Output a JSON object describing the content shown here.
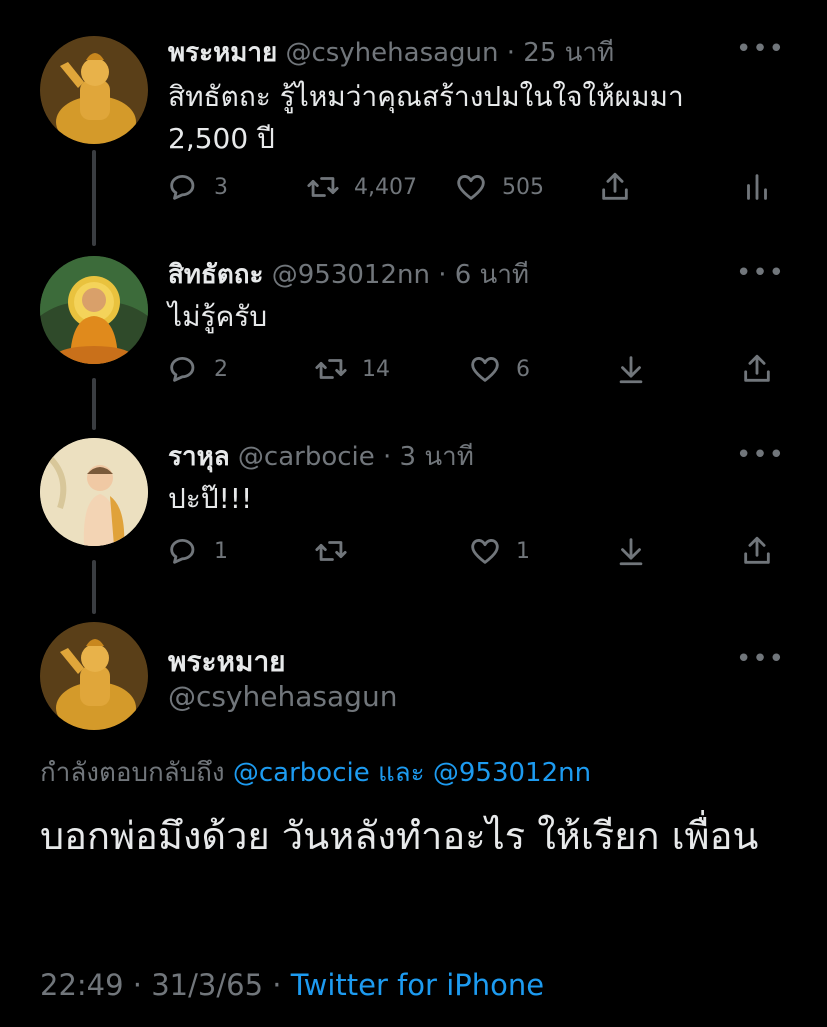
{
  "tweets": [
    {
      "name": "พระหมาย",
      "handle": "@csyhehasagun",
      "time": "· 25 นาที",
      "text": "สิทธัตถะ รู้ไหมว่าคุณสร้างปมในใจให้ผมมา 2,500 ปี",
      "replies": "3",
      "retweets": "4,407",
      "likes": "505"
    },
    {
      "name": "สิทธัตถะ",
      "handle": "@953012nn",
      "time": "· 6 นาที",
      "text": "ไม่รู้ครับ",
      "replies": "2",
      "retweets": "14",
      "likes": "6"
    },
    {
      "name": "ราหุล",
      "handle": "@carbocie",
      "time": "· 3 นาที",
      "text": "ปะป๊!!!",
      "replies": "1",
      "retweets": "",
      "likes": "1"
    }
  ],
  "main": {
    "name": "พระหมาย",
    "handle": "@csyhehasagun",
    "replying_prefix": "กำลังตอบกลับถึง",
    "reply_to_1": "@carbocie",
    "and": "และ",
    "reply_to_2": "@953012nn",
    "text": "บอกพ่อมึงด้วย วันหลังทำอะไร ให้เรียก เพื่อน",
    "timestamp": "22:49 · 31/3/65 ·",
    "source": "Twitter for iPhone"
  },
  "more_label": "•••",
  "icons": {
    "reply": "reply-icon",
    "retweet": "retweet-icon",
    "like": "heart-icon",
    "share": "share-icon",
    "analytics": "analytics-icon",
    "download": "download-icon",
    "more": "more-icon"
  },
  "colors": {
    "accent": "#1d9bf0",
    "muted": "#71767b",
    "text": "#e7e9ea",
    "background": "#000000"
  }
}
